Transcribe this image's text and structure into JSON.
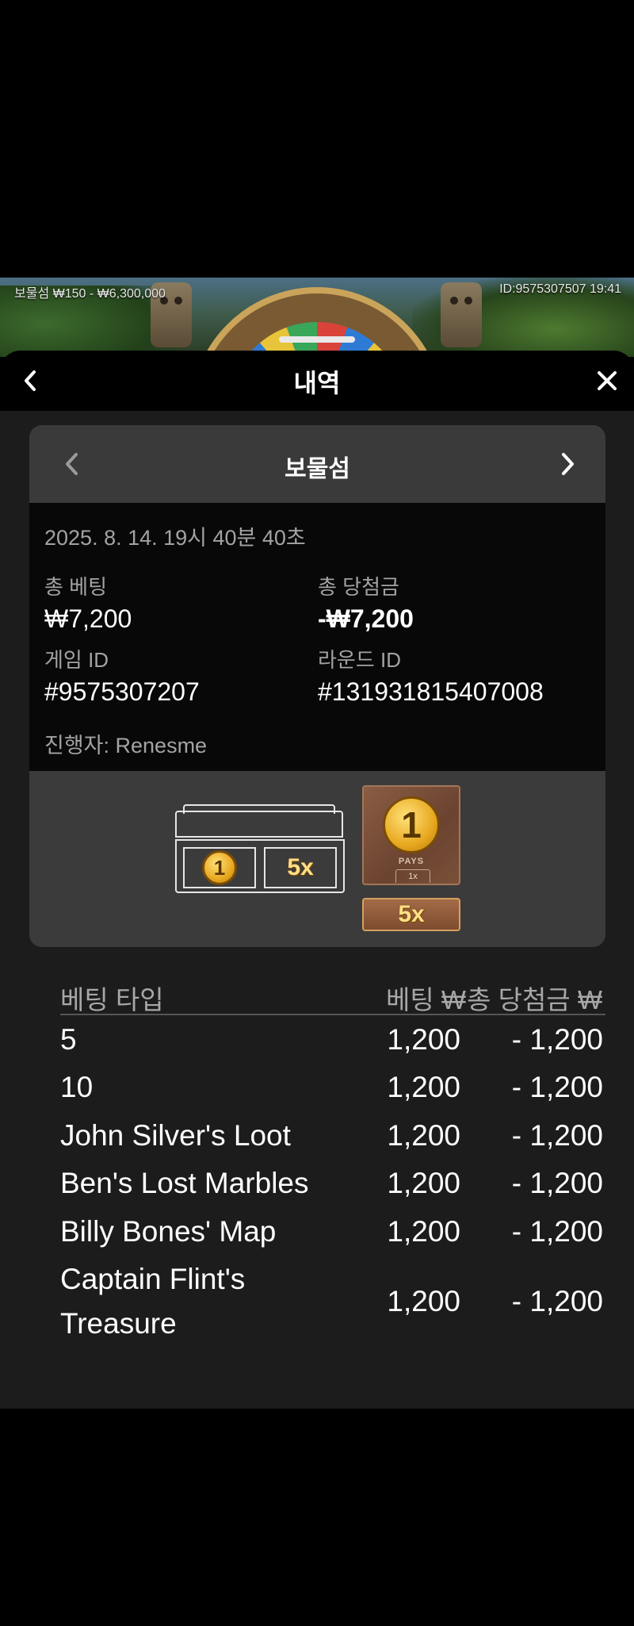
{
  "game_strip": {
    "left_text": "보물섬 ₩150 - ₩6,300,000",
    "right_text": "ID:9575307507 19:41"
  },
  "header": {
    "title": "내역",
    "back_icon": "chevron-left-icon",
    "close_icon": "close-icon"
  },
  "card": {
    "game_name": "보물섬",
    "date": "2025. 8. 14. 19시 40분 40초",
    "total_bet_label": "총 베팅",
    "total_bet_value": "₩7,200",
    "total_win_label": "총 당첨금",
    "total_win_value": "-₩7,200",
    "game_id_label": "게임 ID",
    "game_id_value": "#9575307207",
    "round_id_label": "라운드 ID",
    "round_id_value": "#131931815407008",
    "dealer": "진행자: Renesme"
  },
  "result": {
    "chest_coin": "1",
    "chest_multiplier": "5x",
    "pays_coin": "1",
    "pays_label": "PAYS",
    "pays_multiplier": "1x",
    "multiplier_badge": "5x"
  },
  "table": {
    "headers": {
      "type": "베팅 타입",
      "bet": "베팅 ₩",
      "win": "총 당첨금 ₩"
    },
    "rows": [
      {
        "type": "5",
        "bet": "1,200",
        "win": "- 1,200"
      },
      {
        "type": "10",
        "bet": "1,200",
        "win": "- 1,200"
      },
      {
        "type": "John Silver's Loot",
        "bet": "1,200",
        "win": "- 1,200"
      },
      {
        "type": "Ben's Lost Marbles",
        "bet": "1,200",
        "win": "- 1,200"
      },
      {
        "type": "Billy Bones' Map",
        "bet": "1,200",
        "win": "- 1,200"
      },
      {
        "type_line1": "Captain Flint's",
        "type_line2": "Treasure",
        "bet": "1,200",
        "win": "- 1,200"
      }
    ]
  }
}
